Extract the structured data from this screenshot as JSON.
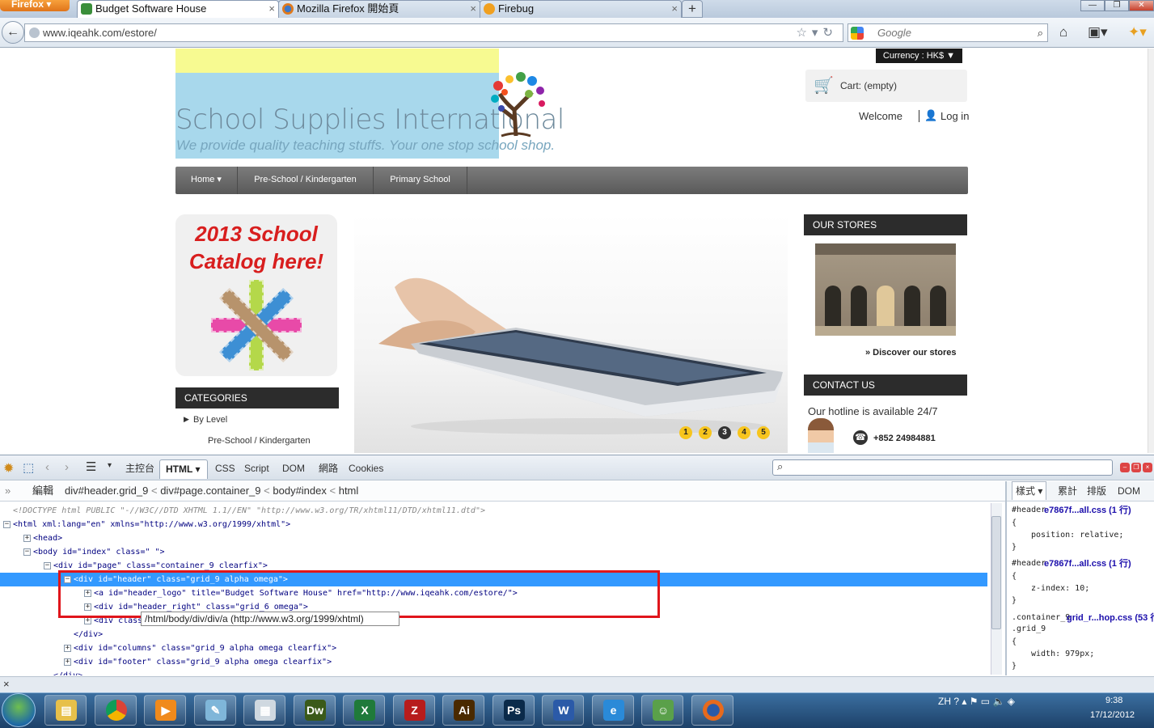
{
  "browser": {
    "app_menu": "Firefox",
    "tabs": [
      {
        "title": "Budget Software House",
        "active": true
      },
      {
        "title": "Mozilla Firefox 開始頁",
        "active": false
      },
      {
        "title": "Firebug",
        "active": false
      }
    ],
    "new_tab": "+",
    "url": "www.iqeahk.com/estore/",
    "search_engine": "Google",
    "window_controls": [
      "—",
      "❐",
      "✕"
    ]
  },
  "store": {
    "logo_title": "School Supplies International",
    "logo_subtitle": "We provide quality teaching stuffs. Your one stop school shop.",
    "currency": "Currency : HK$",
    "cart": "Cart: (empty)",
    "welcome": "Welcome",
    "login": "Log in",
    "menu": [
      "Home",
      "Pre-School / Kindergarten",
      "Primary School"
    ],
    "catalog_banner": "2013 School Catalog here!",
    "categories": {
      "heading": "CATEGORIES",
      "items": [
        "By Level",
        "Pre-School / Kindergarten"
      ]
    },
    "slider_pages": [
      "1",
      "2",
      "3",
      "4",
      "5"
    ],
    "slider_active_page": 3,
    "stores": {
      "heading": "OUR STORES",
      "link": "» Discover our stores"
    },
    "contact": {
      "heading": "CONTACT US",
      "hotline_text": "Our hotline is available 24/7",
      "phone": "+852 24984881"
    }
  },
  "firebug": {
    "toolbar_tabs": [
      "主控台",
      "HTML",
      "CSS",
      "Script",
      "DOM",
      "網路",
      "Cookies"
    ],
    "edit_label": "編輯",
    "breadcrumb": [
      "div#header.grid_9",
      "div#page.container_9",
      "body#index",
      "html"
    ],
    "side_tabs": [
      "樣式",
      "累計",
      "排版",
      "DOM"
    ],
    "html_lines": [
      {
        "indent": 0,
        "twisty": "",
        "text": "<!DOCTYPE html PUBLIC \"-//W3C//DTD XHTML 1.1//EN\" \"http://www.w3.org/TR/xhtml11/DTD/xhtml11.dtd\">",
        "kind": "doctype"
      },
      {
        "indent": 0,
        "twisty": "−",
        "text": "<html xml:lang=\"en\" xmlns=\"http://www.w3.org/1999/xhtml\">"
      },
      {
        "indent": 1,
        "twisty": "+",
        "text": "<head>"
      },
      {
        "indent": 1,
        "twisty": "−",
        "text": "<body id=\"index\" class=\" \">"
      },
      {
        "indent": 2,
        "twisty": "−",
        "text": "<div id=\"page\" class=\"container_9 clearfix\">"
      },
      {
        "indent": 3,
        "twisty": "−",
        "text": "<div id=\"header\" class=\"grid_9 alpha omega\">",
        "selected": true
      },
      {
        "indent": 4,
        "twisty": "+",
        "text": "<a id=\"header_logo\" title=\"Budget Software House\" href=\"http://www.iqeahk.com/estore/\">"
      },
      {
        "indent": 4,
        "twisty": "+",
        "text": "<div id=\"header_right\" class=\"grid_6 omega\">"
      },
      {
        "indent": 4,
        "twisty": "+",
        "text": "<div class"
      },
      {
        "indent": 3,
        "twisty": "",
        "text": "</div>"
      },
      {
        "indent": 3,
        "twisty": "+",
        "text": "<div id=\"columns\" class=\"grid_9 alpha omega clearfix\">"
      },
      {
        "indent": 3,
        "twisty": "+",
        "text": "<div id=\"footer\" class=\"grid_9 alpha omega clearfix\">"
      },
      {
        "indent": 2,
        "twisty": "",
        "text": "</div>"
      }
    ],
    "tooltip": "/html/body/div/div/a (http://www.w3.org/1999/xhtml)",
    "css_rules": [
      {
        "selector": "#header",
        "source": "e7867f...all.css (1 行)",
        "declaration": "position: relative;"
      },
      {
        "selector": "#header",
        "source": "e7867f...all.css (1 行)",
        "declaration": "z-index: 10;"
      },
      {
        "selector": ".container_9 .grid_9",
        "source": "grid_r...hop.css (53 行)",
        "declaration": "width: 979px;"
      }
    ],
    "status": "×"
  },
  "taskbar": {
    "apps": [
      "explorer",
      "chrome",
      "media-player",
      "notepad",
      "calculator",
      "Dw",
      "excel",
      "filezilla",
      "Ai",
      "Ps",
      "word",
      "ie",
      "users",
      "firefox"
    ],
    "language": "ZH",
    "time": "9:38",
    "date": "17/12/2012"
  },
  "colors": {
    "selection": "#3399ff",
    "highlight_box": "#e0151b",
    "menu_bar": "#6b6b6b",
    "slider_dot": "#f7c51d"
  }
}
